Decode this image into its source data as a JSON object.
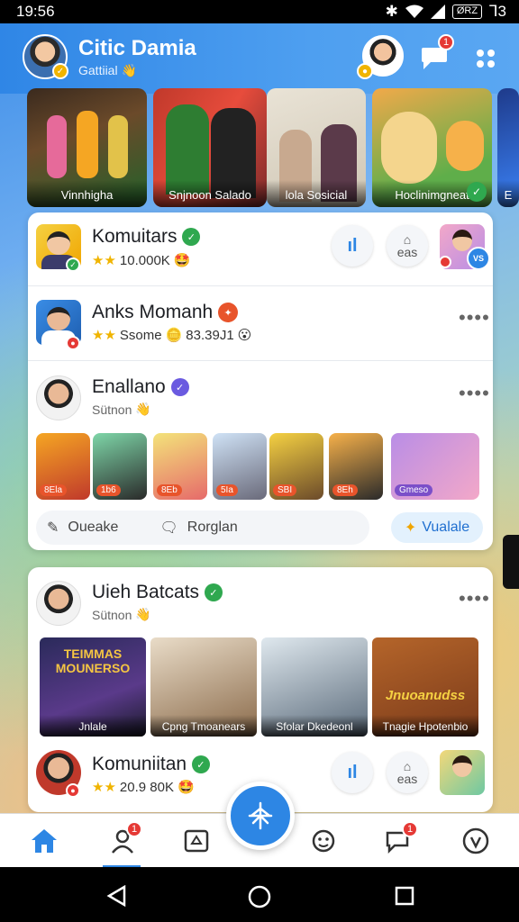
{
  "status_bar": {
    "time": "19:56",
    "battery": "ØRZ",
    "extra": "Ꞁ3"
  },
  "header": {
    "title": "Citic Damia",
    "subtitle": "Gattiial",
    "message_badge": "1"
  },
  "stories": [
    {
      "label": "Vinnhigha"
    },
    {
      "label": "Snjnoon Salado"
    },
    {
      "label": "lola Sosicial"
    },
    {
      "label": "Hoclinimgneat"
    },
    {
      "label": "E"
    }
  ],
  "feed": {
    "row1": {
      "name": "Komuitars",
      "stars": "★★",
      "count": "10.000K",
      "button2_label": "eas"
    },
    "row2": {
      "name": "Anks Momanh",
      "stars": "★★",
      "meta_label": "Ssome",
      "count": "83.39J1"
    },
    "row3": {
      "name": "Enallano",
      "sub": "Sütnon",
      "thumb_tags": [
        "8Ela",
        "1b6",
        "8Eb",
        "5Ia",
        "SBI",
        "8Eh",
        "Gmeso"
      ],
      "action1_label": "Oueake",
      "action2_label": "Rorglan",
      "action3_label": "Vualale"
    }
  },
  "card2": {
    "name": "Uieh Batcats",
    "sub": "Sütnon",
    "photos": [
      {
        "poster": "TEIMMAS MOUNERSO",
        "caption": "Jnlale"
      },
      {
        "poster": "",
        "caption": "Cpng Tmoanears"
      },
      {
        "poster": "",
        "caption": "Sfolar Dkedeonl"
      },
      {
        "poster": "Jnuoanudss",
        "caption": "Tnagie Hpotenbio"
      }
    ],
    "footer": {
      "name": "Komuniitan",
      "stars": "★★",
      "count": "20.9 80K",
      "button2_label": "eas"
    }
  },
  "nav": {
    "badge_people": "1",
    "badge_chat": "1"
  },
  "colors": {
    "primary": "#2d86e4",
    "badge": "#e53935",
    "verified": "#2fa84f"
  }
}
